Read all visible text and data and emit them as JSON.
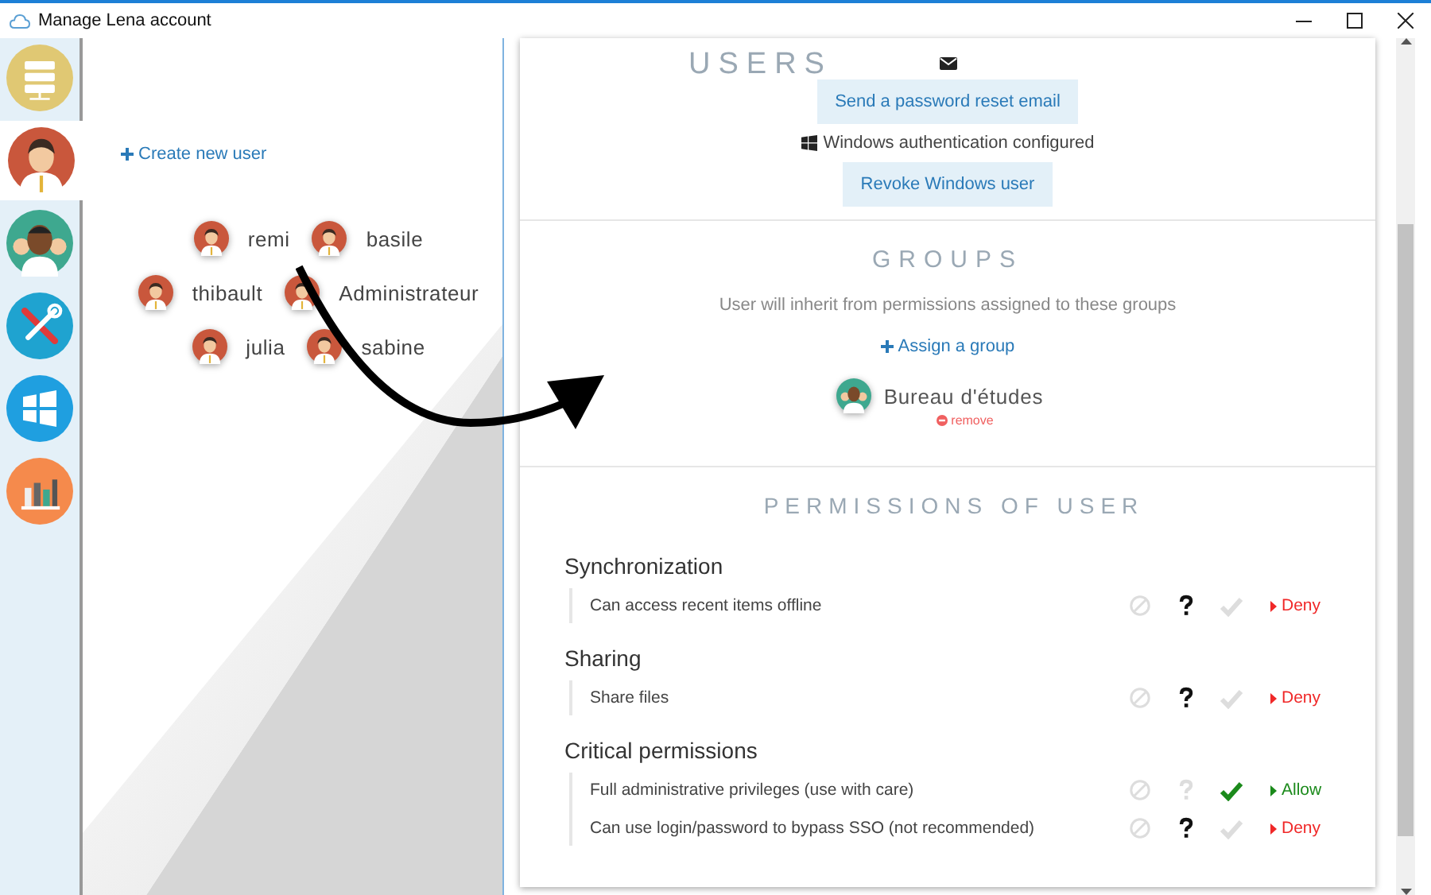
{
  "window": {
    "title": "Manage Lena account"
  },
  "sidebar": {
    "items": [
      {
        "kind": "server",
        "selected": false
      },
      {
        "kind": "user",
        "selected": true
      },
      {
        "kind": "group",
        "selected": false
      },
      {
        "kind": "tools",
        "selected": false
      },
      {
        "kind": "windows",
        "selected": false
      },
      {
        "kind": "chart",
        "selected": false
      }
    ]
  },
  "users_pane": {
    "create_link": "Create new user",
    "users": [
      "remi",
      "basile",
      "thibault",
      "Administrateur",
      "julia",
      "sabine"
    ]
  },
  "user_panel": {
    "heading": "USERS",
    "password_button": "Send a password reset email",
    "windows_status": "Windows authentication configured",
    "revoke_button": "Revoke Windows user",
    "groups": {
      "heading": "GROUPS",
      "hint": "User will inherit from permissions assigned to these groups",
      "assign_link": "Assign a group",
      "items": [
        {
          "name": "Bureau d'études",
          "remove": "remove"
        }
      ]
    },
    "permissions": {
      "heading": "PERMISSIONS OF USER",
      "sections": [
        {
          "title": "Synchronization",
          "items": [
            {
              "label": "Can access recent items offline",
              "options": [
                {
                  "kind": "ban",
                  "selected": false
                },
                {
                  "kind": "question",
                  "selected": true
                },
                {
                  "kind": "check",
                  "selected": false
                }
              ],
              "result": {
                "label": "Deny",
                "allowed": false
              }
            }
          ]
        },
        {
          "title": "Sharing",
          "items": [
            {
              "label": "Share files",
              "options": [
                {
                  "kind": "ban",
                  "selected": false
                },
                {
                  "kind": "question",
                  "selected": true
                },
                {
                  "kind": "check",
                  "selected": false
                }
              ],
              "result": {
                "label": "Deny",
                "allowed": false
              }
            }
          ]
        },
        {
          "title": "Critical permissions",
          "items": [
            {
              "label": "Full administrative privileges (use with care)",
              "options": [
                {
                  "kind": "ban",
                  "selected": false
                },
                {
                  "kind": "question",
                  "selected": false
                },
                {
                  "kind": "check",
                  "selected": true
                }
              ],
              "result": {
                "label": "Allow",
                "allowed": true
              }
            },
            {
              "label": "Can use login/password to bypass SSO (not recommended)",
              "options": [
                {
                  "kind": "ban",
                  "selected": false
                },
                {
                  "kind": "question",
                  "selected": true
                },
                {
                  "kind": "check",
                  "selected": false
                }
              ],
              "result": {
                "label": "Deny",
                "allowed": false
              }
            }
          ]
        }
      ]
    }
  }
}
